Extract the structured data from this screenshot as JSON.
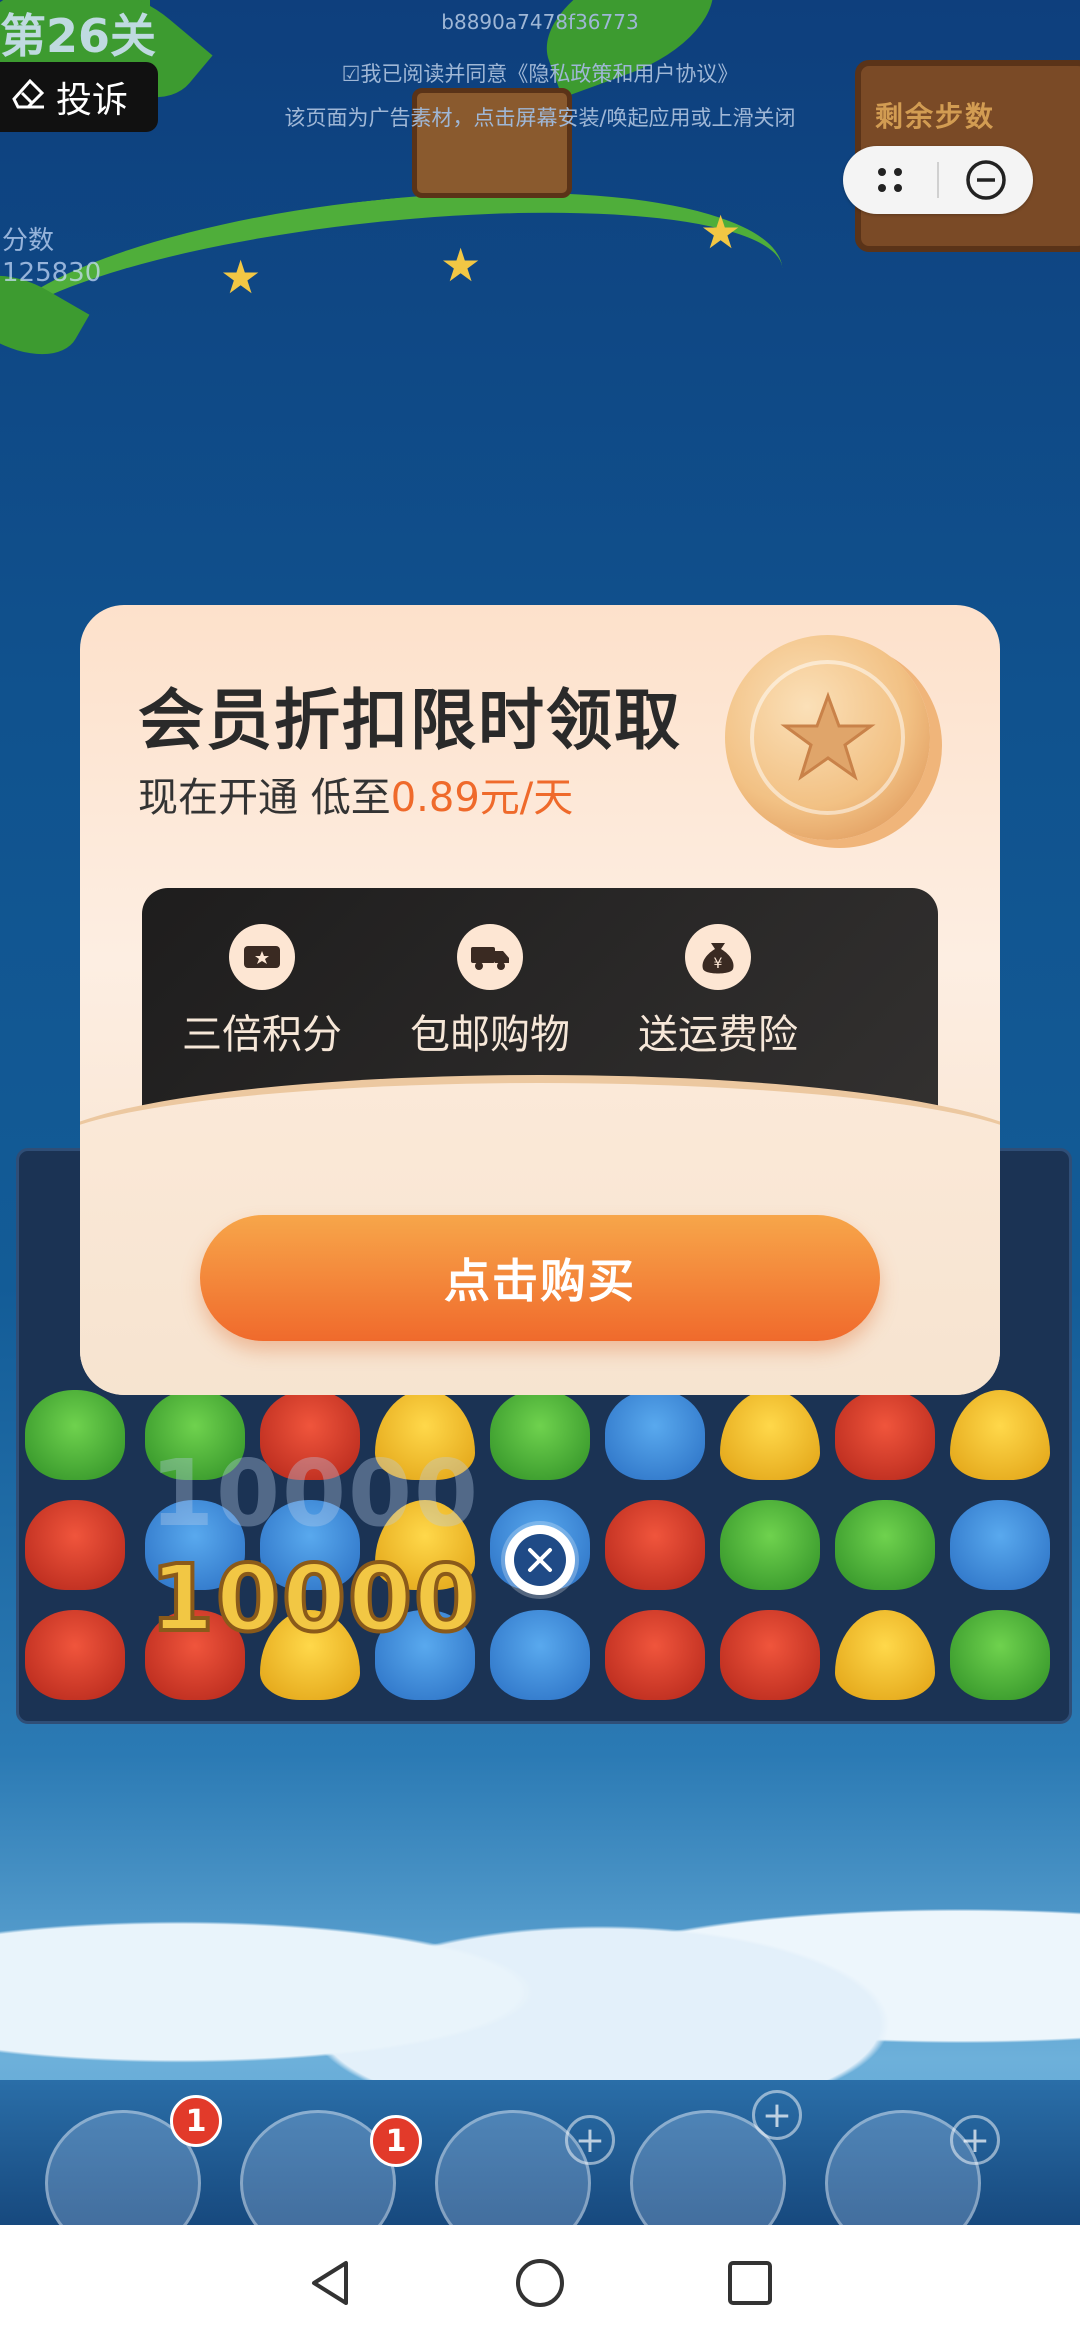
{
  "top": {
    "ad_id": "b8890a7478f36773",
    "notice_agreement": "☑我已阅读并同意《隐私政策和用户协议》",
    "notice_ad": "该页面为广告素材，点击屏幕安装/唤起应用或上滑关闭",
    "complaint_label": "投诉"
  },
  "game": {
    "level_title": "第26关",
    "score_label": "分数",
    "score_value": "125830",
    "steps_label": "剩余步数",
    "bonus": "10000",
    "bonus_faded": "10000",
    "badges": [
      "1",
      "1"
    ]
  },
  "card": {
    "title": "会员折扣限时领取",
    "subtitle_prefix": "现在开通 低至",
    "subtitle_price": "0.89元/天",
    "benefits": [
      {
        "label": "三倍积分",
        "icon": "ticket-icon"
      },
      {
        "label": "包邮购物",
        "icon": "truck-icon"
      },
      {
        "label": "送运费险",
        "icon": "money-bag-icon"
      }
    ],
    "buy_label": "点击购买"
  },
  "colors": {
    "accent_orange": "#ef6a2b",
    "card_bg": "#fde1cb",
    "benefit_bg": "#1e1d1d"
  }
}
